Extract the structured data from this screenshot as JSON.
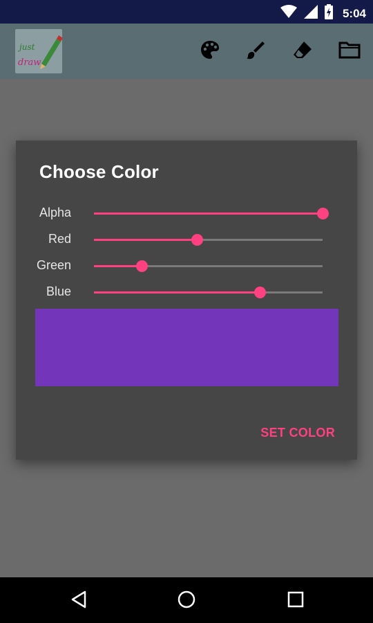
{
  "status_bar": {
    "time": "5:04",
    "icons": [
      "wifi-icon",
      "signal-icon",
      "battery-charging-icon"
    ]
  },
  "app_bar": {
    "logo_text": [
      "just",
      "draw"
    ],
    "actions": [
      {
        "name": "palette-icon"
      },
      {
        "name": "brush-icon"
      },
      {
        "name": "eraser-icon"
      },
      {
        "name": "folder-icon"
      }
    ]
  },
  "dialog": {
    "title": "Choose Color",
    "sliders": [
      {
        "label": "Alpha",
        "value": 255,
        "max": 255
      },
      {
        "label": "Red",
        "value": 115,
        "max": 255
      },
      {
        "label": "Green",
        "value": 53,
        "max": 255
      },
      {
        "label": "Blue",
        "value": 185,
        "max": 255
      }
    ],
    "preview_color": "#7335b9",
    "action_label": "SET COLOR"
  },
  "colors": {
    "accent": "#ff4081",
    "dialog_bg": "#464646",
    "status_bar": "#141a47",
    "app_bar": "#596d72"
  },
  "nav_bar": {
    "buttons": [
      "back-icon",
      "home-icon",
      "recents-icon"
    ]
  }
}
